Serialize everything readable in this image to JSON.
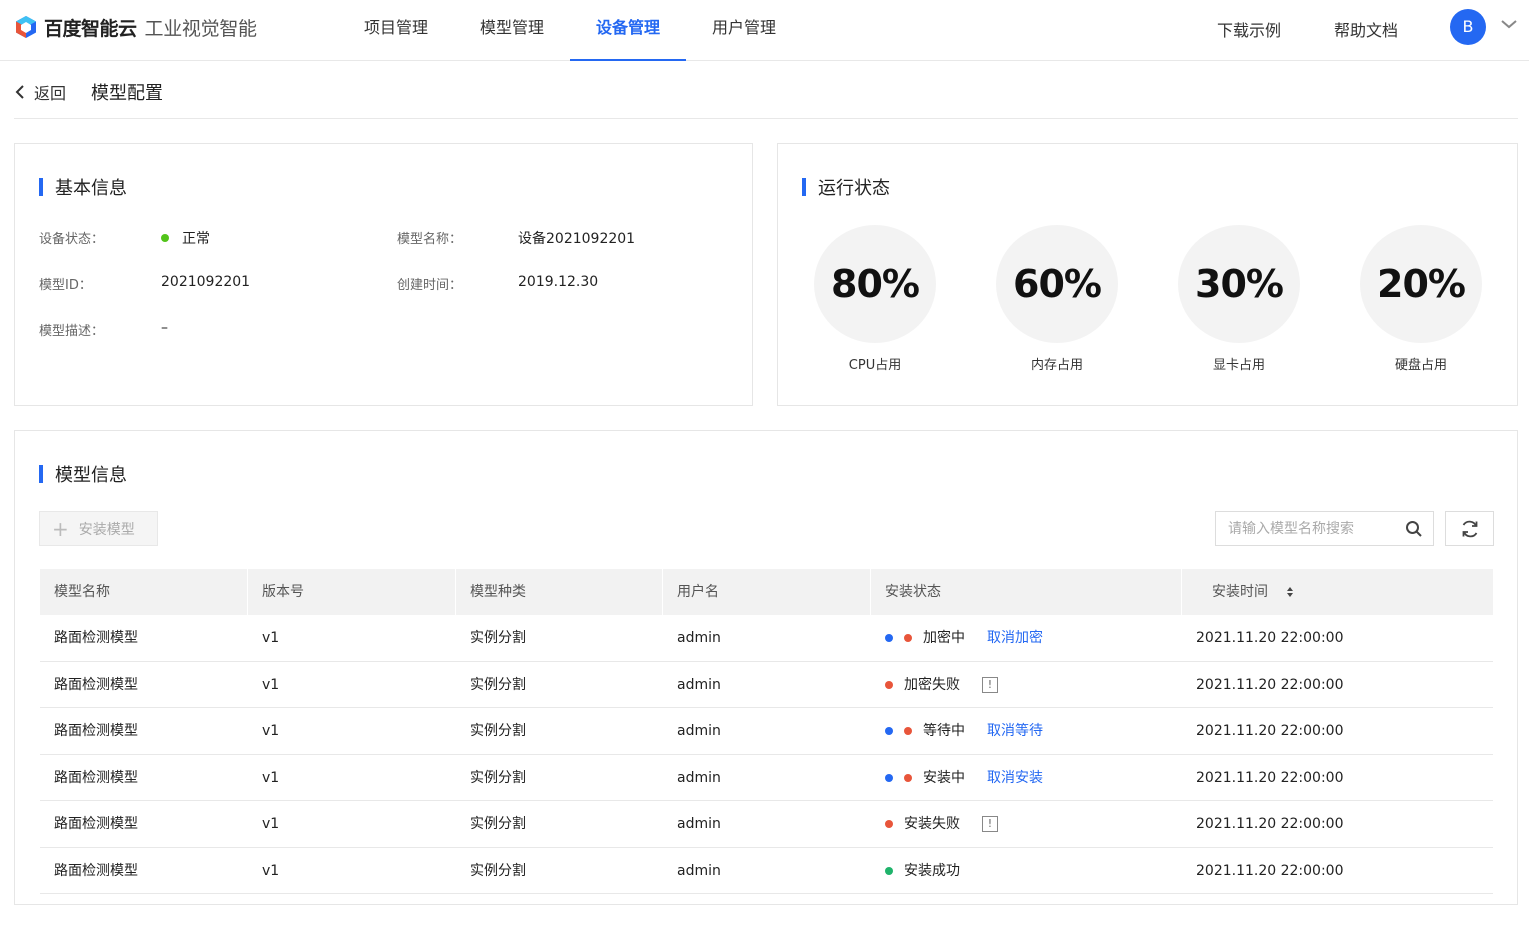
{
  "header": {
    "brand": "百度智能云",
    "product": "工业视觉智能",
    "nav": [
      {
        "label": "项目管理",
        "active": false
      },
      {
        "label": "模型管理",
        "active": false
      },
      {
        "label": "设备管理",
        "active": true
      },
      {
        "label": "用户管理",
        "active": false
      }
    ],
    "download_label": "下载示例",
    "help_label": "帮助文档",
    "avatar_letter": "B"
  },
  "breadcrumb": {
    "back_label": "返回",
    "title": "模型配置"
  },
  "basic_info": {
    "title": "基本信息",
    "device_status_label": "设备状态：",
    "device_status_value": "正常",
    "model_name_label": "模型名称：",
    "model_name_value": "设备2021092201",
    "model_id_label": "模型ID：",
    "model_id_value": "2021092201",
    "created_label": "创建时间：",
    "created_value": "2019.12.30",
    "desc_label": "模型描述：",
    "desc_value": "–"
  },
  "run_status": {
    "title": "运行状态",
    "gauges": [
      {
        "value": "80%",
        "label": "CPU占用"
      },
      {
        "value": "60%",
        "label": "内存占用"
      },
      {
        "value": "30%",
        "label": "显卡占用"
      },
      {
        "value": "20%",
        "label": "硬盘占用"
      }
    ]
  },
  "model_info": {
    "title": "模型信息",
    "install_button": "安装模型",
    "search_placeholder": "请输入模型名称搜索",
    "columns": [
      "模型名称",
      "版本号",
      "模型种类",
      "用户名",
      "安装状态",
      "安装时间"
    ],
    "rows": [
      {
        "name": "路面检测模型",
        "version": "v1",
        "type": "实例分割",
        "user": "admin",
        "status": "加密中",
        "dots": [
          "#2468f2",
          "#e8553a"
        ],
        "action": "取消加密",
        "warn": false,
        "time": "2021.11.20 22:00:00"
      },
      {
        "name": "路面检测模型",
        "version": "v1",
        "type": "实例分割",
        "user": "admin",
        "status": "加密失败",
        "dots": [
          "#e8553a"
        ],
        "action": "",
        "warn": true,
        "time": "2021.11.20 22:00:00"
      },
      {
        "name": "路面检测模型",
        "version": "v1",
        "type": "实例分割",
        "user": "admin",
        "status": "等待中",
        "dots": [
          "#2468f2",
          "#e8553a"
        ],
        "action": "取消等待",
        "warn": false,
        "time": "2021.11.20 22:00:00"
      },
      {
        "name": "路面检测模型",
        "version": "v1",
        "type": "实例分割",
        "user": "admin",
        "status": "安装中",
        "dots": [
          "#2468f2",
          "#e8553a"
        ],
        "action": "取消安装",
        "warn": false,
        "time": "2021.11.20 22:00:00"
      },
      {
        "name": "路面检测模型",
        "version": "v1",
        "type": "实例分割",
        "user": "admin",
        "status": "安装失败",
        "dots": [
          "#e8553a"
        ],
        "action": "",
        "warn": true,
        "time": "2021.11.20 22:00:00"
      },
      {
        "name": "路面检测模型",
        "version": "v1",
        "type": "实例分割",
        "user": "admin",
        "status": "安装成功",
        "dots": [
          "#1fb36b"
        ],
        "action": "",
        "warn": false,
        "time": "2021.11.20 22:00:00"
      }
    ]
  },
  "colors": {
    "accent": "#2468f2",
    "ok": "#52c41a",
    "error": "#e8553a",
    "success": "#1fb36b"
  }
}
